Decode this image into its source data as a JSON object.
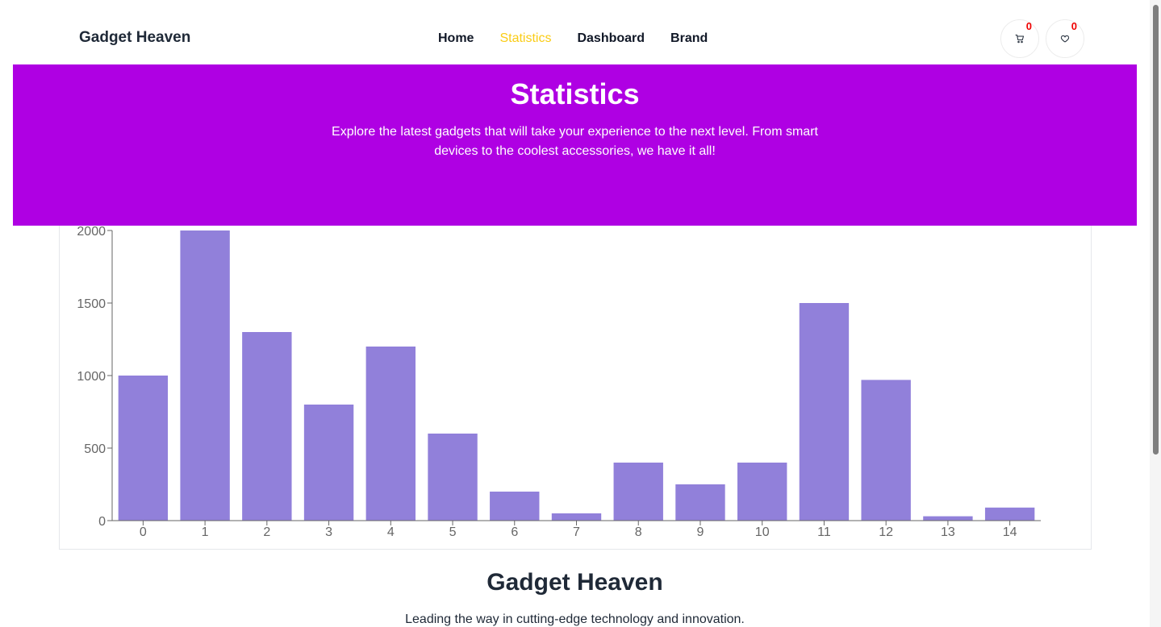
{
  "navbar": {
    "brand": "Gadget Heaven",
    "links": [
      {
        "label": "Home"
      },
      {
        "label": "Statistics",
        "active": true
      },
      {
        "label": "Dashboard"
      },
      {
        "label": "Brand"
      }
    ],
    "cart": {
      "icon": "cart-icon",
      "count": "0"
    },
    "wishlist": {
      "icon": "heart-icon",
      "count": "0"
    }
  },
  "banner": {
    "title": "Statistics",
    "description": "Explore the latest gadgets that will take your experience to the next level. From smart devices to the coolest accessories, we have it all!"
  },
  "colors": {
    "accent": "#af00e3",
    "active_link": "#facc15",
    "bar": "#9180da",
    "badge": "#ef0000"
  },
  "chart_data": {
    "type": "bar",
    "categories": [
      "0",
      "1",
      "2",
      "3",
      "4",
      "5",
      "6",
      "7",
      "8",
      "9",
      "10",
      "11",
      "12",
      "13",
      "14"
    ],
    "values": [
      1000,
      2000,
      1300,
      800,
      1200,
      600,
      200,
      50,
      400,
      250,
      400,
      1500,
      970,
      30,
      90
    ],
    "y_ticks": [
      0,
      500,
      1000,
      1500,
      2000
    ],
    "ylim": [
      0,
      2000
    ],
    "title": "",
    "xlabel": "",
    "ylabel": "",
    "grid": false
  },
  "footer": {
    "title": "Gadget Heaven",
    "tagline": "Leading the way in cutting-edge technology and innovation."
  }
}
